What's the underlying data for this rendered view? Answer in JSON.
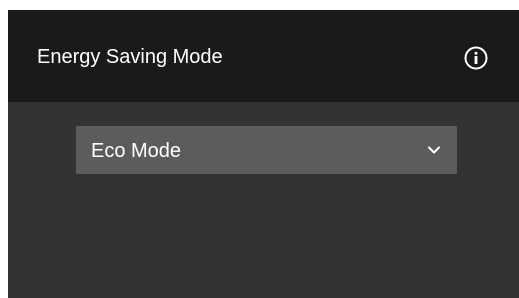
{
  "panel": {
    "title": "Energy Saving Mode",
    "info_icon": "info-circle-icon"
  },
  "mode_select": {
    "selected": "Eco Mode",
    "chevron_icon": "chevron-down-icon"
  },
  "colors": {
    "header_bg": "#1a1a1a",
    "panel_bg": "#333333",
    "select_bg": "#5c5c5c",
    "text": "#ffffff"
  }
}
